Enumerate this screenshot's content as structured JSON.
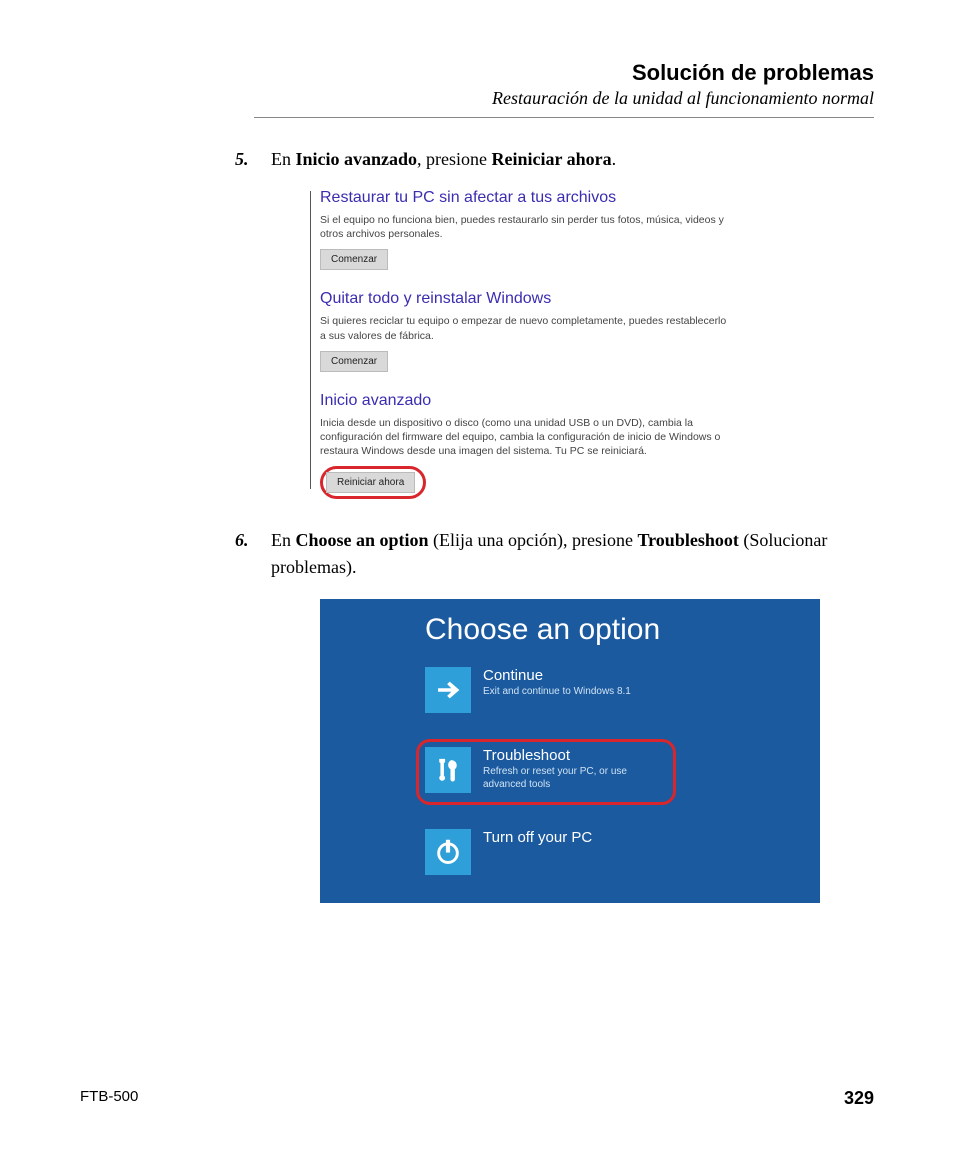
{
  "header": {
    "title": "Solución de problemas",
    "subtitle": "Restauración de la unidad al funcionamiento normal"
  },
  "steps": {
    "s5": {
      "num": "5.",
      "pre": "En ",
      "b1": "Inicio avanzado",
      "mid": ", presione ",
      "b2": "Reiniciar ahora",
      "post": "."
    },
    "s6": {
      "num": "6.",
      "pre": "En ",
      "b1": "Choose an option",
      "mid1": " (Elija una opción), presione ",
      "b2": "Troubleshoot",
      "mid2": " (Solucionar problemas)."
    }
  },
  "shot1": {
    "sec1": {
      "title": "Restaurar tu PC sin afectar a tus archivos",
      "desc": "Si el equipo no funciona bien, puedes restaurarlo sin perder tus fotos, música, videos y otros archivos personales.",
      "btn": "Comenzar"
    },
    "sec2": {
      "title": "Quitar todo y reinstalar Windows",
      "desc": "Si quieres reciclar tu equipo o empezar de nuevo completamente, puedes restablecerlo a sus valores de fábrica.",
      "btn": "Comenzar"
    },
    "sec3": {
      "title": "Inicio avanzado",
      "desc": "Inicia desde un dispositivo o disco (como una unidad USB o un DVD), cambia la configuración del firmware del equipo, cambia la configuración de inicio de Windows o restaura Windows desde una imagen del sistema. Tu PC se reiniciará.",
      "btn": "Reiniciar ahora"
    }
  },
  "shot2": {
    "title": "Choose an option",
    "opt1": {
      "label": "Continue",
      "sub": "Exit and continue to Windows 8.1"
    },
    "opt2": {
      "label": "Troubleshoot",
      "sub": "Refresh or reset your PC, or use advanced tools"
    },
    "opt3": {
      "label": "Turn off your PC",
      "sub": ""
    }
  },
  "footer": {
    "left": "FTB-500",
    "page": "329"
  }
}
